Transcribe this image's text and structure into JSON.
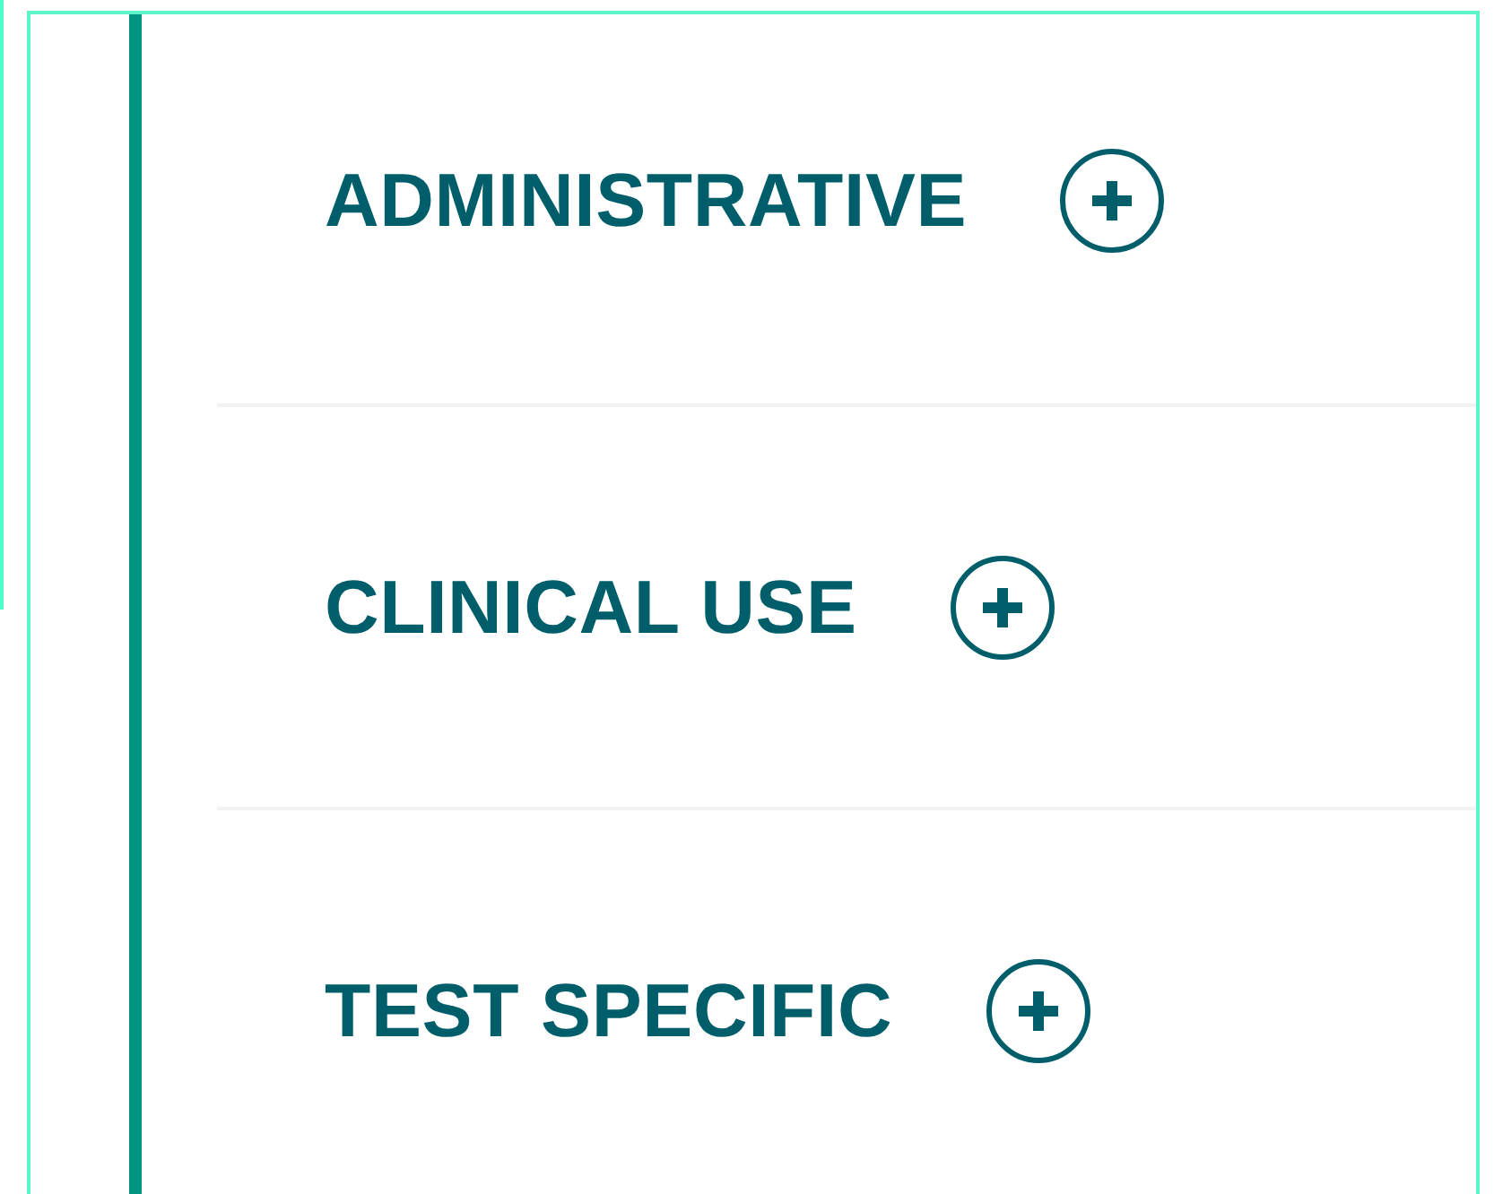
{
  "sections": [
    {
      "title": "ADMINISTRATIVE",
      "expanded": false
    },
    {
      "title": "CLINICAL USE",
      "expanded": false
    },
    {
      "title": "TEST SPECIFIC",
      "expanded": false
    }
  ]
}
